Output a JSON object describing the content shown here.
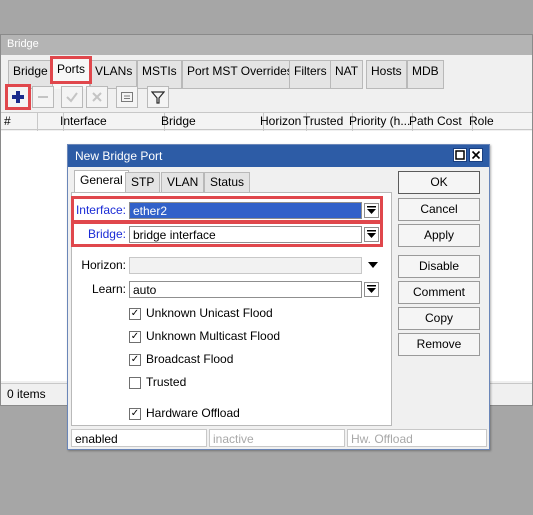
{
  "bridge_window": {
    "title": "Bridge",
    "tabs": [
      "Bridge",
      "Ports",
      "VLANs",
      "MSTIs",
      "Port MST Overrides",
      "Filters",
      "NAT",
      "Hosts",
      "MDB"
    ],
    "active_tab": "Ports",
    "toolbar": {
      "add": "add-icon",
      "remove": "minus-icon",
      "enable": "check-icon",
      "disable": "x-icon",
      "comment": "comment-icon",
      "filter": "filter-icon"
    },
    "columns": [
      "#",
      "",
      "Interface",
      "Bridge",
      "Horizon",
      "Trusted",
      "Priority (h...",
      "Path Cost",
      "Role"
    ],
    "status": "0 items"
  },
  "dialog": {
    "title": "New Bridge Port",
    "tabs": [
      "General",
      "STP",
      "VLAN",
      "Status"
    ],
    "active_tab": "General",
    "fields": {
      "interface": {
        "label": "Interface:",
        "value": "ether2"
      },
      "bridge": {
        "label": "Bridge:",
        "value": "bridge interface"
      },
      "horizon": {
        "label": "Horizon:",
        "value": ""
      },
      "learn": {
        "label": "Learn:",
        "value": "auto"
      }
    },
    "checkboxes": [
      {
        "label": "Unknown Unicast Flood",
        "checked": true
      },
      {
        "label": "Unknown Multicast Flood",
        "checked": true
      },
      {
        "label": "Broadcast Flood",
        "checked": true
      },
      {
        "label": "Trusted",
        "checked": false
      },
      {
        "label": "Hardware Offload",
        "checked": true
      }
    ],
    "buttons": [
      "OK",
      "Cancel",
      "Apply",
      "Disable",
      "Comment",
      "Copy",
      "Remove"
    ],
    "status": [
      "enabled",
      "inactive",
      "Hw. Offload"
    ],
    "window_buttons": {
      "maximize": "maximize-icon",
      "close": "close-icon"
    }
  },
  "colors": {
    "highlight": "#e0474c",
    "dialog_title": "#2d5ca6",
    "selection": "#3261c9",
    "label_blue": "#1a2bd6"
  }
}
